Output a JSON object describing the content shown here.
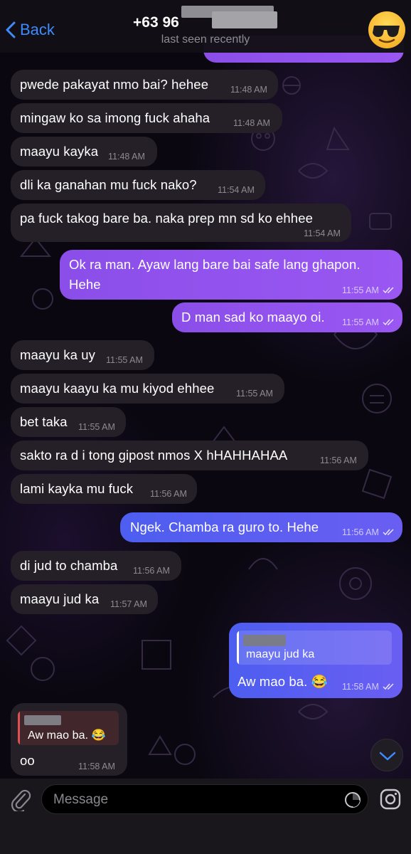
{
  "header": {
    "back_label": "Back",
    "contact_name": "+63 96",
    "status": "last seen recently",
    "avatar": "sunglasses-emoji"
  },
  "messages": [
    {
      "text": "pwede pakayat nmo bai? hehee",
      "time": "11:48 AM",
      "direction": "in"
    },
    {
      "text": "mingaw ko sa imong fuck ahaha",
      "time": "11:48 AM",
      "direction": "in"
    },
    {
      "text": "maayu kayka",
      "time": "11:48 AM",
      "direction": "in"
    },
    {
      "text": "dli ka ganahan mu fuck nako?",
      "time": "11:54 AM",
      "direction": "in"
    },
    {
      "text": "pa fuck takog bare ba. naka prep mn sd ko ehhee",
      "time": "11:54 AM",
      "direction": "in"
    },
    {
      "line1": "Ok ra man. Ayaw lang bare bai safe lang ghapon.",
      "line2": "Hehe",
      "time": "11:55 AM",
      "direction": "out",
      "status": "read"
    },
    {
      "text": "D man sad ko maayo oi.",
      "time": "11:55 AM",
      "direction": "out",
      "status": "read"
    },
    {
      "text": "maayu ka uy",
      "time": "11:55 AM",
      "direction": "in"
    },
    {
      "text": "maayu kaayu ka mu kiyod ehhee",
      "time": "11:55 AM",
      "direction": "in"
    },
    {
      "text": "bet taka",
      "time": "11:55 AM",
      "direction": "in"
    },
    {
      "text": "sakto ra d i tong gipost nmos X hHAHHAHAA",
      "time": "11:56 AM",
      "direction": "in"
    },
    {
      "text": "lami kayka mu fuck",
      "time": "11:56 AM",
      "direction": "in"
    },
    {
      "text": "Ngek. Chamba ra guro to. Hehe",
      "time": "11:56 AM",
      "direction": "out",
      "status": "read"
    },
    {
      "text": "di jud to chamba",
      "time": "11:56 AM",
      "direction": "in"
    },
    {
      "text": "maayu jud ka",
      "time": "11:57 AM",
      "direction": "in"
    },
    {
      "reply_quote": "maayu jud ka",
      "text": "Aw mao ba. 😂",
      "time": "11:58 AM",
      "direction": "out",
      "status": "read"
    },
    {
      "reply_quote": "Aw mao ba. 😂",
      "text": "oo",
      "time": "11:58 AM",
      "direction": "in"
    }
  ],
  "composer": {
    "placeholder": "Message",
    "attach_icon": "paperclip-icon",
    "sticker_icon": "sticker-icon",
    "camera_icon": "instagram-camera-icon"
  },
  "colors": {
    "incoming_bubble": "#252027",
    "outgoing_bubble": "#9451ee",
    "outgoing_bubble_alt": "#5a5ef0",
    "accent": "#3d8bfd"
  }
}
